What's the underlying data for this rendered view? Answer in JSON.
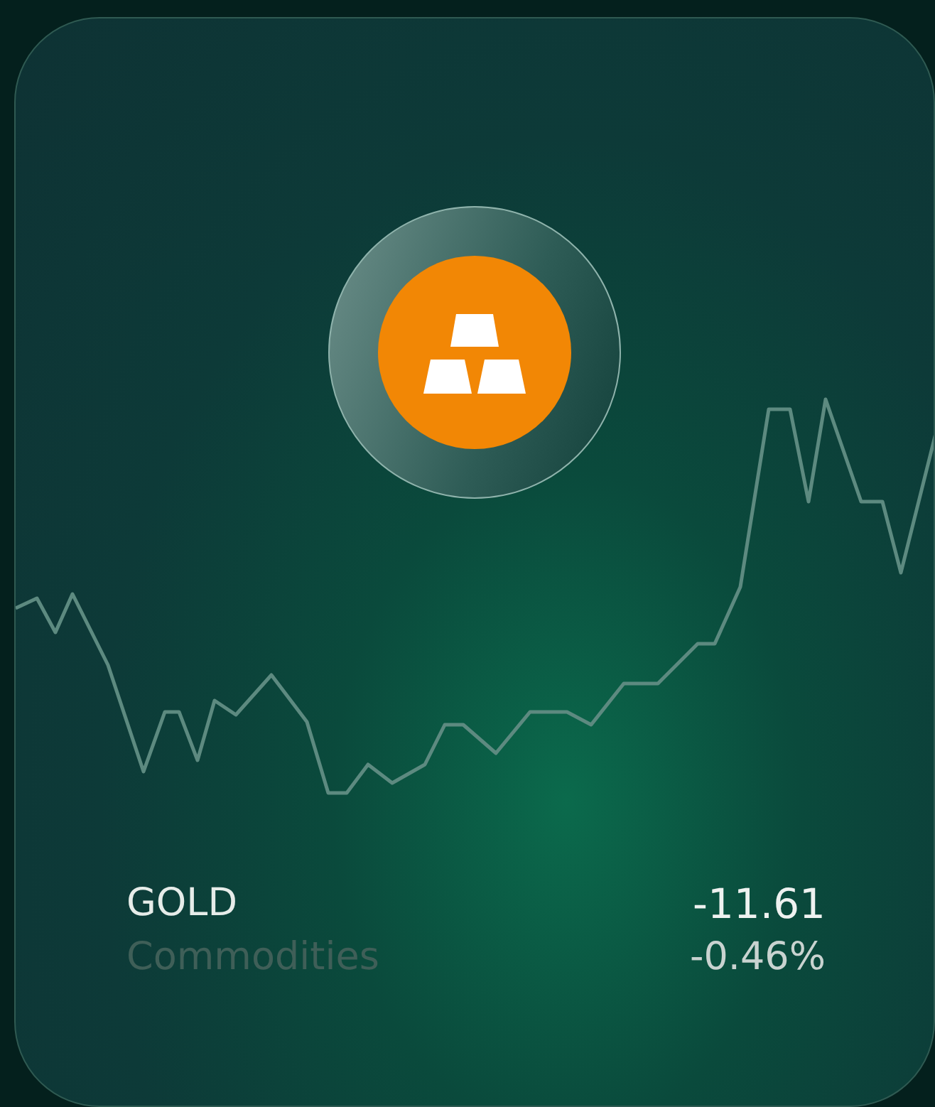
{
  "asset": {
    "name": "GOLD",
    "category": "Commodities",
    "change": "-11.61",
    "change_percent": "-0.46%"
  }
}
